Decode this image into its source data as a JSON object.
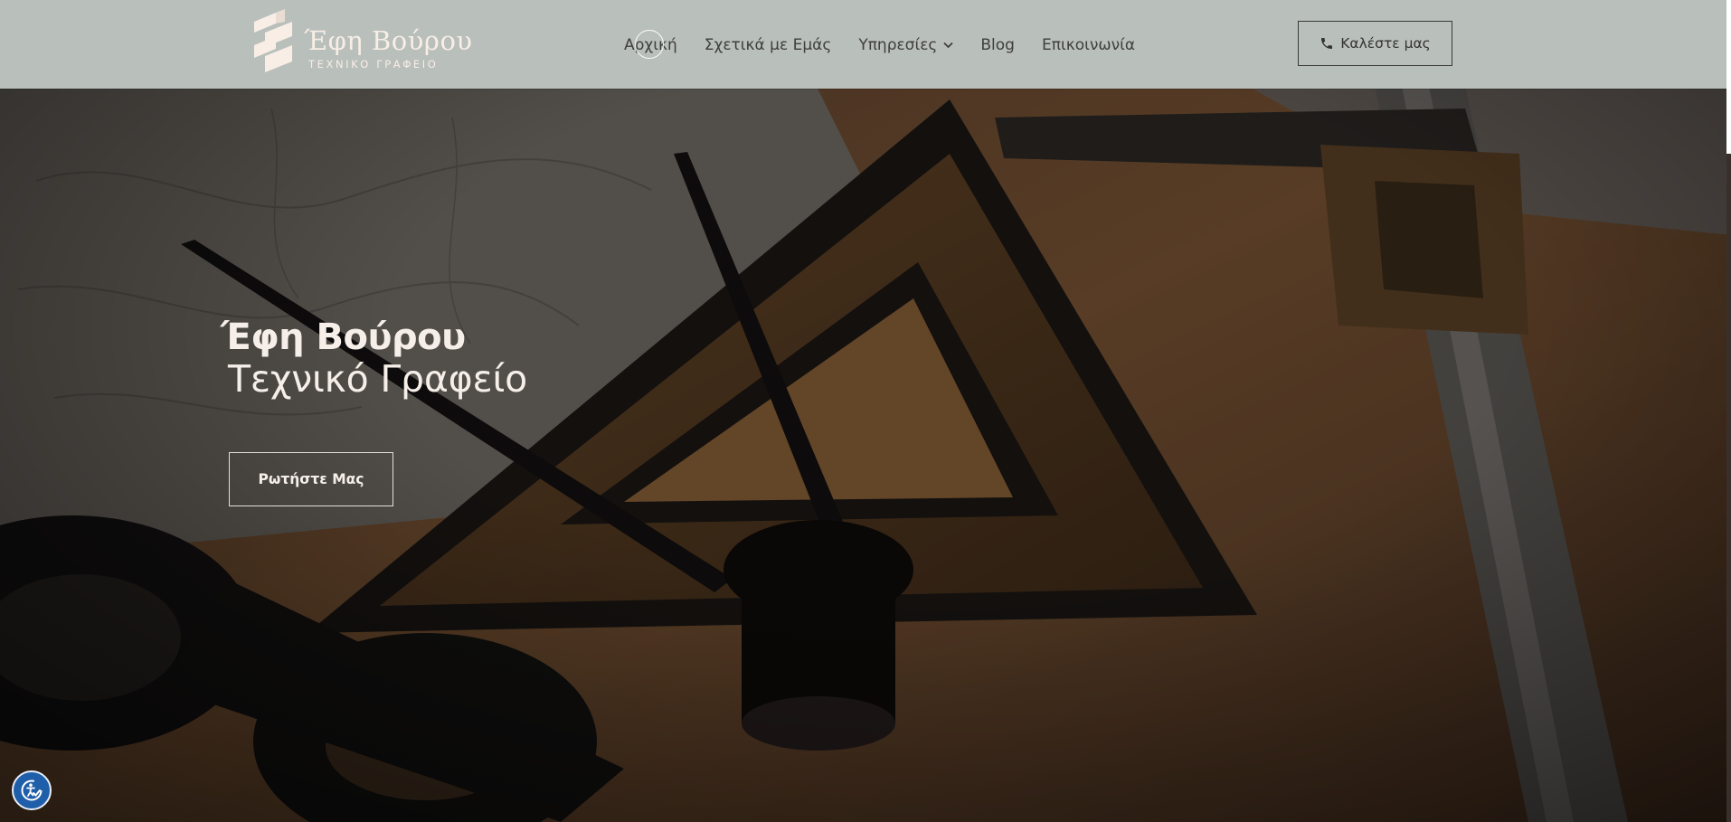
{
  "brand": {
    "name": "Έφη Βούρου",
    "subtitle": "ΤΕΧΝΙΚΟ ΓΡΑΦΕΙΟ"
  },
  "nav": {
    "items": [
      {
        "label": "Αρχική"
      },
      {
        "label": "Σχετικά με Εμάς"
      },
      {
        "label": "Υπηρεσίες",
        "has_dropdown": true
      },
      {
        "label": "Blog"
      },
      {
        "label": "Επικοινωνία"
      }
    ],
    "dropdown_icon": "chevron-down-icon"
  },
  "call_button": {
    "label": "Καλέστε μας",
    "icon": "phone-icon"
  },
  "hero": {
    "title": "Έφη Βούρου",
    "subtitle": "Τεχνικό Γραφείο",
    "cta_label": "Ρωτήστε Μας"
  },
  "accessibility": {
    "icon": "accessibility-icon"
  },
  "colors": {
    "header_bg": "#b9bfbb",
    "accent": "#f8eee6",
    "a11y_blue": "#1f5ea8"
  }
}
